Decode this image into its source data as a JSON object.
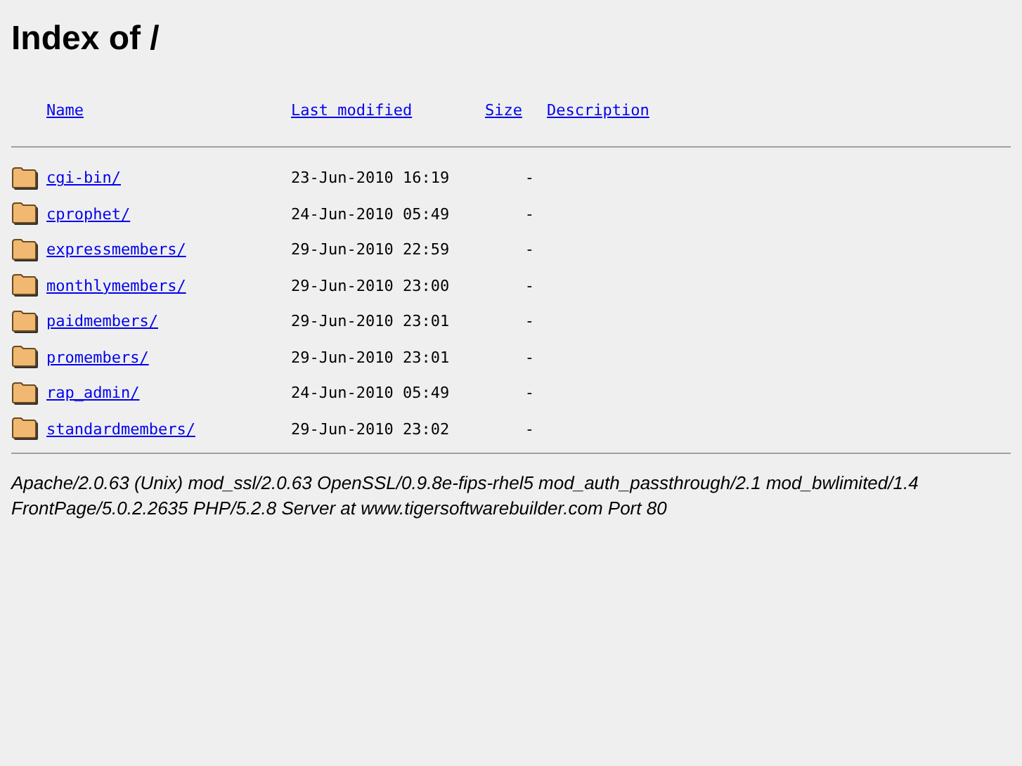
{
  "title": "Index of /",
  "columns": [
    "Name",
    "Last modified",
    "Size",
    "Description"
  ],
  "rows": [
    {
      "name": "cgi-bin/",
      "modified": "23-Jun-2010 16:19",
      "size": "-"
    },
    {
      "name": "cprophet/",
      "modified": "24-Jun-2010 05:49",
      "size": "-"
    },
    {
      "name": "expressmembers/",
      "modified": "29-Jun-2010 22:59",
      "size": "-"
    },
    {
      "name": "monthlymembers/",
      "modified": "29-Jun-2010 23:00",
      "size": "-"
    },
    {
      "name": "paidmembers/",
      "modified": "29-Jun-2010 23:01",
      "size": "-"
    },
    {
      "name": "promembers/",
      "modified": "29-Jun-2010 23:01",
      "size": "-"
    },
    {
      "name": "rap_admin/",
      "modified": "24-Jun-2010 05:49",
      "size": "-"
    },
    {
      "name": "standardmembers/",
      "modified": "29-Jun-2010 23:02",
      "size": "-"
    }
  ],
  "footer": [
    "Apache/2.0.63 (Unix) mod_ssl/2.0.63 OpenSSL/0.9.8e-fips-rhel5 mod_auth_passthrough/2.1 mod_bwlimited/1.4",
    "FrontPage/5.0.2.2635 PHP/5.2.8 Server at www.tigersoftwarebuilder.com Port 80"
  ]
}
